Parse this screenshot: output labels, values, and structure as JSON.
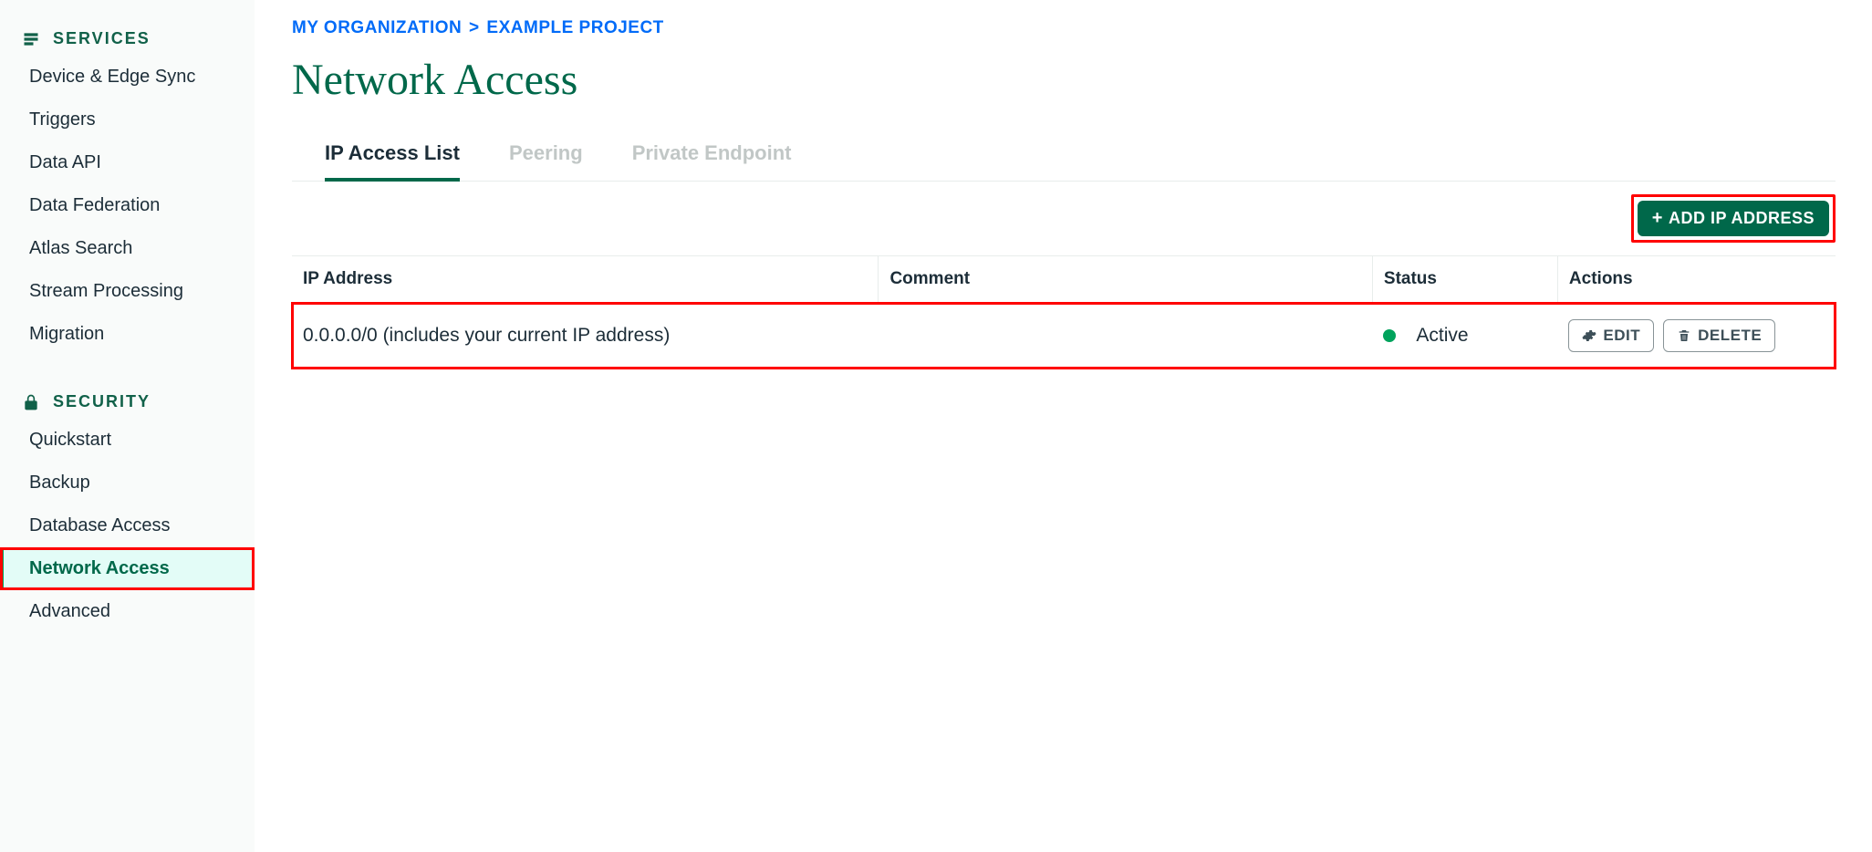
{
  "sidebar": {
    "sections": [
      {
        "title": "SERVICES",
        "items": [
          {
            "label": "Device & Edge Sync",
            "name": "sidebar-item-device-sync"
          },
          {
            "label": "Triggers",
            "name": "sidebar-item-triggers"
          },
          {
            "label": "Data API",
            "name": "sidebar-item-data-api"
          },
          {
            "label": "Data Federation",
            "name": "sidebar-item-data-federation"
          },
          {
            "label": "Atlas Search",
            "name": "sidebar-item-atlas-search"
          },
          {
            "label": "Stream Processing",
            "name": "sidebar-item-stream-processing"
          },
          {
            "label": "Migration",
            "name": "sidebar-item-migration"
          }
        ]
      },
      {
        "title": "SECURITY",
        "items": [
          {
            "label": "Quickstart",
            "name": "sidebar-item-quickstart"
          },
          {
            "label": "Backup",
            "name": "sidebar-item-backup"
          },
          {
            "label": "Database Access",
            "name": "sidebar-item-database-access"
          },
          {
            "label": "Network Access",
            "name": "sidebar-item-network-access",
            "active": true,
            "highlight": true
          },
          {
            "label": "Advanced",
            "name": "sidebar-item-advanced"
          }
        ]
      }
    ]
  },
  "breadcrumb": {
    "org": "MY ORGANIZATION",
    "project": "EXAMPLE PROJECT",
    "sep": ">"
  },
  "page": {
    "title": "Network Access"
  },
  "tabs": [
    {
      "label": "IP Access List",
      "active": true
    },
    {
      "label": "Peering",
      "active": false
    },
    {
      "label": "Private Endpoint",
      "active": false
    }
  ],
  "buttons": {
    "add_ip": "ADD IP ADDRESS",
    "edit": "EDIT",
    "delete": "DELETE"
  },
  "table": {
    "headers": {
      "ip": "IP Address",
      "comment": "Comment",
      "status": "Status",
      "actions": "Actions"
    },
    "rows": [
      {
        "ip": "0.0.0.0/0  (includes your current IP address)",
        "comment": "",
        "status": "Active",
        "status_color": "#00a35c",
        "highlight": true
      }
    ]
  }
}
